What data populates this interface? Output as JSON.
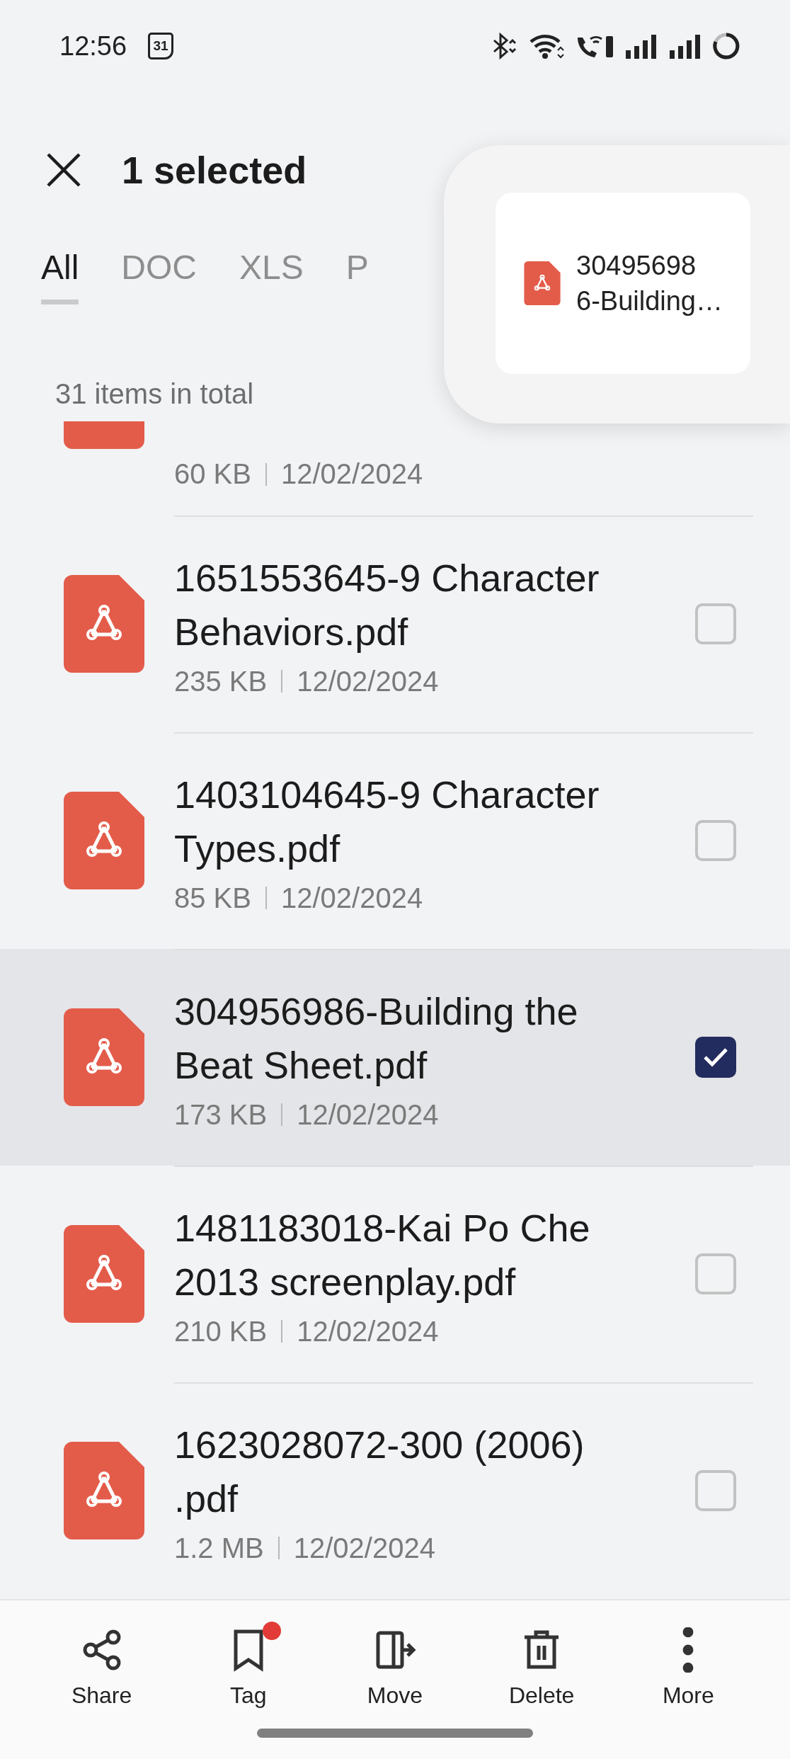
{
  "status_bar": {
    "time": "12:56",
    "calendar_day": "31"
  },
  "header": {
    "title": "1 selected"
  },
  "tabs": [
    {
      "label": "All",
      "selected": true
    },
    {
      "label": "DOC",
      "selected": false
    },
    {
      "label": "XLS",
      "selected": false
    },
    {
      "label": "P",
      "selected": false
    }
  ],
  "summary": "31 items in total",
  "files": [
    {
      "kind": "partial",
      "size": "60 KB",
      "date": "12/02/2024"
    },
    {
      "kind": "full",
      "name": "1651553645-9 Character Behaviors.pdf",
      "size": "235 KB",
      "date": "12/02/2024",
      "checked": false
    },
    {
      "kind": "full",
      "name": "1403104645-9 Character Types.pdf",
      "size": "85 KB",
      "date": "12/02/2024",
      "checked": false
    },
    {
      "kind": "full",
      "name": "304956986-Building the Beat Sheet.pdf",
      "size": "173 KB",
      "date": "12/02/2024",
      "checked": true
    },
    {
      "kind": "full",
      "name": "1481183018-Kai Po Che 2013 screenplay.pdf",
      "size": "210 KB",
      "date": "12/02/2024",
      "checked": false
    },
    {
      "kind": "full",
      "name": "1623028072-300 (2006) .pdf",
      "size": "1.2 MB",
      "date": "12/02/2024",
      "checked": false
    }
  ],
  "drag_preview": {
    "name_line1": "30495698",
    "name_line2": "6-Building…"
  },
  "actions": [
    {
      "kind": "share",
      "label": "Share",
      "badge": false
    },
    {
      "kind": "tag",
      "label": "Tag",
      "badge": true
    },
    {
      "kind": "move",
      "label": "Move",
      "badge": false
    },
    {
      "kind": "delete",
      "label": "Delete",
      "badge": false
    },
    {
      "kind": "more",
      "label": "More",
      "badge": false
    }
  ]
}
